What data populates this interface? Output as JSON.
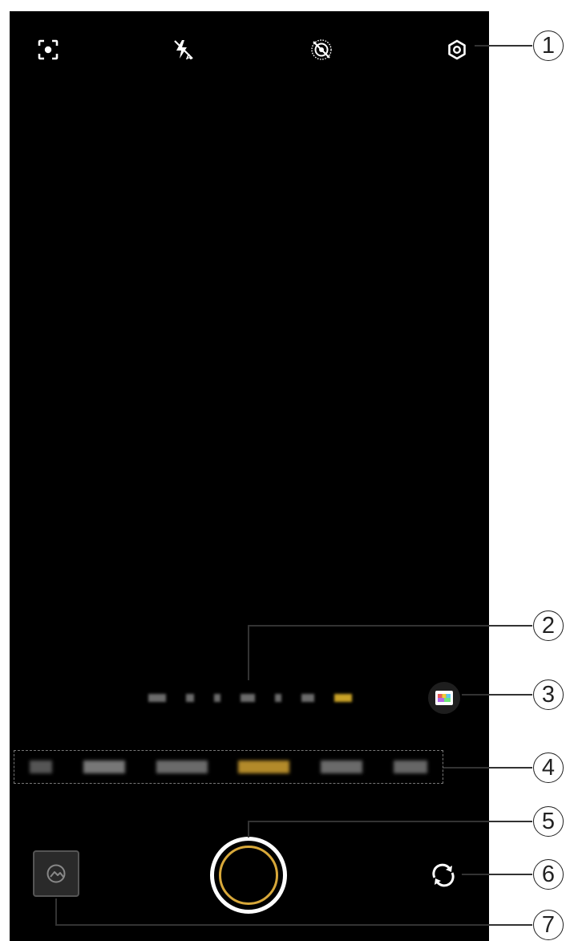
{
  "top_bar": {
    "icons": [
      {
        "name": "focus-frame-icon"
      },
      {
        "name": "flash-off-icon"
      },
      {
        "name": "live-photo-off-icon"
      },
      {
        "name": "settings-gear-icon"
      }
    ]
  },
  "zoom_bar": {
    "segments": 7,
    "active_index": 6
  },
  "filter_button": {
    "icon": "filter-film-icon"
  },
  "mode_strip": {
    "count": 6,
    "active_index": 3
  },
  "shutter": {
    "accent_color": "#d8a83a"
  },
  "gallery": {
    "icon": "gallery-thumbnail-icon"
  },
  "switch_camera": {
    "icon": "switch-camera-icon"
  },
  "callouts": [
    "1",
    "2",
    "3",
    "4",
    "5",
    "6",
    "7"
  ],
  "colors": {
    "background": "#000000",
    "accent": "#d8a83a",
    "callout_line": "#333333"
  }
}
